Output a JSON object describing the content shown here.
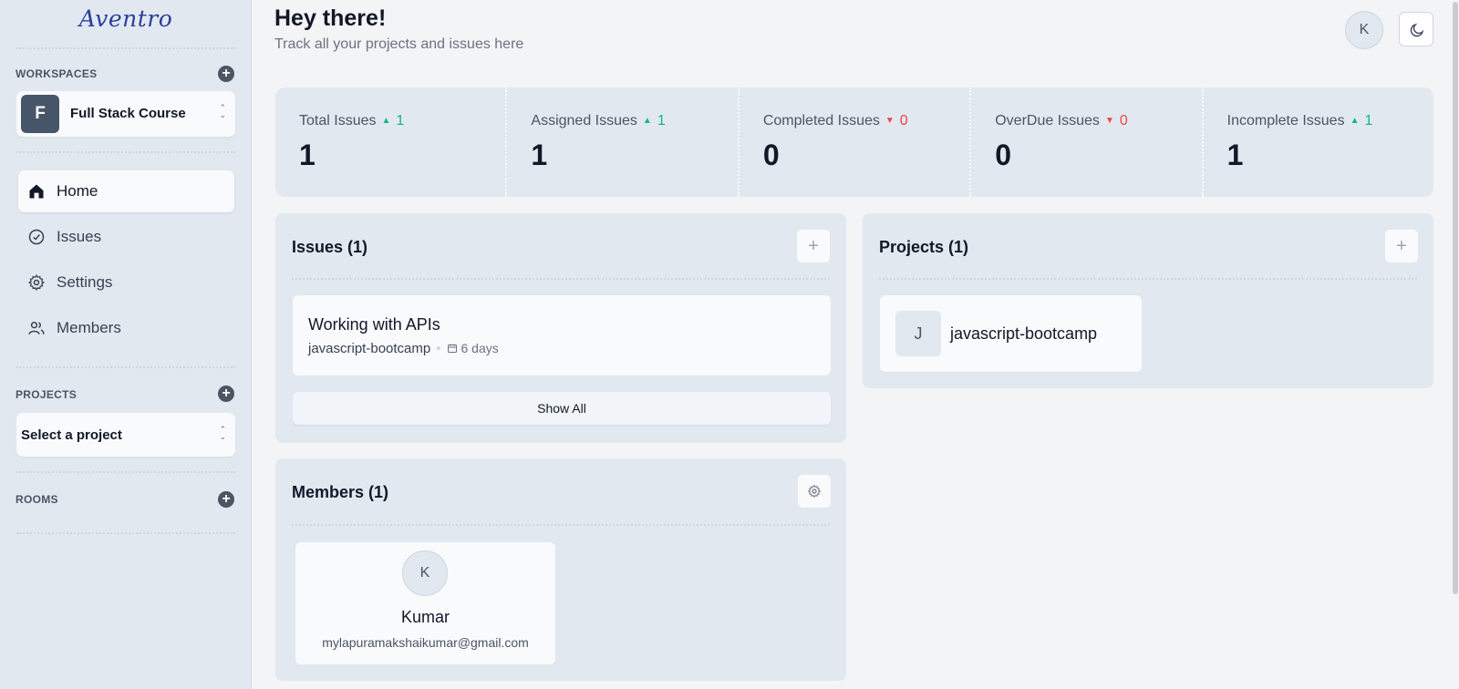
{
  "app": {
    "logo": "Aventro"
  },
  "sidebar": {
    "workspaces_title": "WORKSPACES",
    "workspace": {
      "initial": "F",
      "name": "Full Stack Course"
    },
    "nav": [
      {
        "label": "Home",
        "icon": "home-icon",
        "active": true
      },
      {
        "label": "Issues",
        "icon": "check-circle-icon",
        "active": false
      },
      {
        "label": "Settings",
        "icon": "gear-icon",
        "active": false
      },
      {
        "label": "Members",
        "icon": "users-icon",
        "active": false
      }
    ],
    "projects_title": "PROJECTS",
    "project_select": "Select a project",
    "rooms_title": "ROOMS"
  },
  "header": {
    "greeting": "Hey there!",
    "subtitle": "Track all your projects and issues here",
    "user_initial": "K"
  },
  "stats": [
    {
      "label": "Total Issues",
      "trend": "up",
      "delta": "1",
      "value": "1"
    },
    {
      "label": "Assigned Issues",
      "trend": "up",
      "delta": "1",
      "value": "1"
    },
    {
      "label": "Completed Issues",
      "trend": "down",
      "delta": "0",
      "value": "0"
    },
    {
      "label": "OverDue Issues",
      "trend": "down",
      "delta": "0",
      "value": "0"
    },
    {
      "label": "Incomplete Issues",
      "trend": "up",
      "delta": "1",
      "value": "1"
    }
  ],
  "issues_card": {
    "title": "Issues (1)",
    "items": [
      {
        "title": "Working with APIs",
        "project": "javascript-bootcamp",
        "due": "6 days"
      }
    ],
    "show_all": "Show All"
  },
  "projects_card": {
    "title": "Projects (1)",
    "items": [
      {
        "initial": "J",
        "name": "javascript-bootcamp"
      }
    ]
  },
  "members_card": {
    "title": "Members (1)",
    "items": [
      {
        "initial": "K",
        "name": "Kumar",
        "email": "mylapuramakshaikumar@gmail.com"
      }
    ]
  },
  "colors": {
    "accent_up": "#10b981",
    "accent_down": "#ef4444",
    "logo": "#2b3f9e"
  }
}
